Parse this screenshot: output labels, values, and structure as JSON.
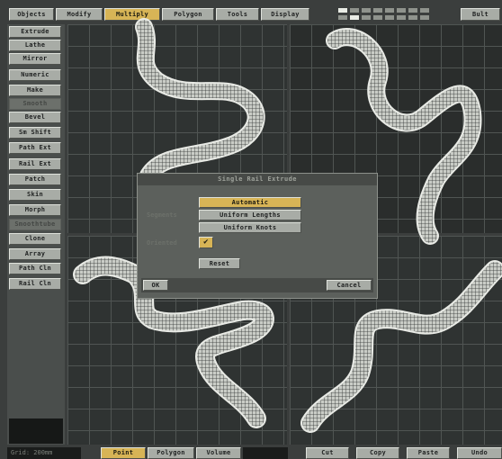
{
  "menu_tabs": [
    {
      "label": "Objects",
      "active": false
    },
    {
      "label": "Modify",
      "active": false
    },
    {
      "label": "Multiply",
      "active": true
    },
    {
      "label": "Polygon",
      "active": false
    },
    {
      "label": "Tools",
      "active": false
    },
    {
      "label": "Display",
      "active": false
    }
  ],
  "top_right_button": "Bult",
  "side_buttons": [
    {
      "label": "Extrude",
      "enabled": true
    },
    {
      "label": "Lathe",
      "enabled": true
    },
    {
      "label": "Mirror",
      "enabled": true
    },
    {
      "label": "Numeric",
      "enabled": true
    },
    {
      "label": "Make",
      "enabled": true
    },
    {
      "label": "Smooth",
      "enabled": false
    },
    {
      "label": "Bevel",
      "enabled": true
    },
    {
      "label": "Sm Shift",
      "enabled": true
    },
    {
      "label": "Path Ext",
      "enabled": true
    },
    {
      "label": "Rail Ext",
      "enabled": true
    },
    {
      "label": "Patch",
      "enabled": true
    },
    {
      "label": "Skin",
      "enabled": true
    },
    {
      "label": "Morph",
      "enabled": true
    },
    {
      "label": "Smoothtube",
      "enabled": false
    },
    {
      "label": "Clone",
      "enabled": true
    },
    {
      "label": "Array",
      "enabled": true
    },
    {
      "label": "Path Cln",
      "enabled": true
    },
    {
      "label": "Rail Cln",
      "enabled": true
    }
  ],
  "dialog": {
    "title": "Single Rail Extrude",
    "segments_label": "Segments",
    "options": [
      {
        "label": "Automatic",
        "selected": true
      },
      {
        "label": "Uniform Lengths",
        "selected": false
      },
      {
        "label": "Uniform Knots",
        "selected": false
      }
    ],
    "oriented_label": "Oriented",
    "oriented_check": "✔",
    "reset_label": "Reset",
    "ok_label": "OK",
    "cancel_label": "Cancel"
  },
  "bottom_bar": {
    "status_text": "Grid: 200mm",
    "modes": [
      {
        "label": "Point",
        "active": true
      },
      {
        "label": "Polygon",
        "active": false
      },
      {
        "label": "Volume",
        "active": false
      }
    ],
    "edit_buttons": [
      "Cut",
      "Copy",
      "Paste",
      "Undo"
    ]
  },
  "colors": {
    "accent": "#d7b456",
    "button_face": "#a8aca6",
    "viewport_bg": "#2f3332",
    "grid_line": "#505553",
    "mesh_wire": "#e6e8e3",
    "dialog_bg": "#5c605c"
  }
}
